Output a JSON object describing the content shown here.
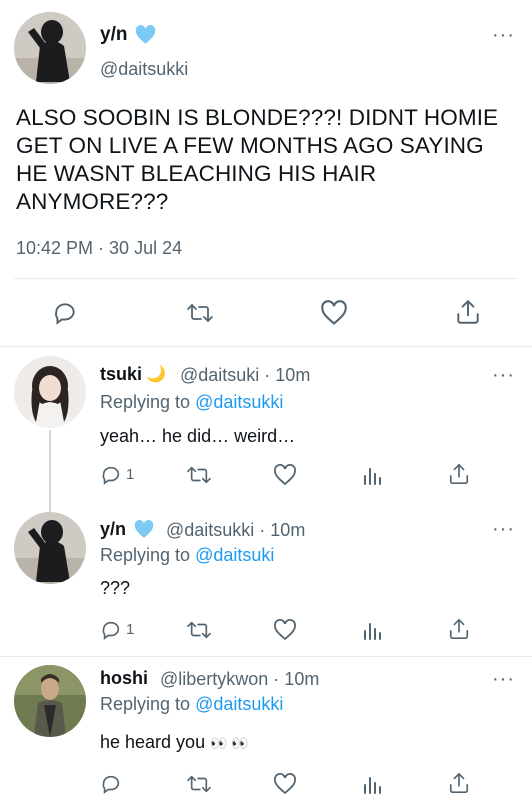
{
  "main_tweet": {
    "name": "y/n",
    "handle": "@daitsukki",
    "text": "ALSO SOOBIN IS BLONDE???! DIDNT HOMIE GET ON LIVE A FEW MONTHS AGO SAYING HE WASNT BLEACHING HIS HAIR ANYMORE???",
    "timestamp": "10:42 PM · 30 Jul 24"
  },
  "replies": [
    {
      "name": "tsuki",
      "emoji": "🌙",
      "meta": "@daitsuki · 10m",
      "replying_label": "Replying to",
      "replying_handle": "@daitsukki",
      "text": "yeah… he did… weird…",
      "reply_count": "1"
    },
    {
      "name": "y/n",
      "meta": "@daitsukki · 10m",
      "replying_label": "Replying to",
      "replying_handle": "@daitsuki",
      "text": "???",
      "reply_count": "1"
    },
    {
      "name": "hoshi",
      "meta": "@libertykwon · 10m",
      "replying_label": "Replying to",
      "replying_handle": "@daitsukki",
      "text": "he heard you",
      "emoji": "👀 👀",
      "reply_count": ""
    }
  ],
  "colors": {
    "accent": "#1d9bf0",
    "muted": "#536471",
    "verified": "#1d9bf0"
  },
  "icons": [
    "reply-icon",
    "retweet-icon",
    "like-icon",
    "analytics-icon",
    "share-icon",
    "more-icon",
    "verified-heart-icon"
  ]
}
